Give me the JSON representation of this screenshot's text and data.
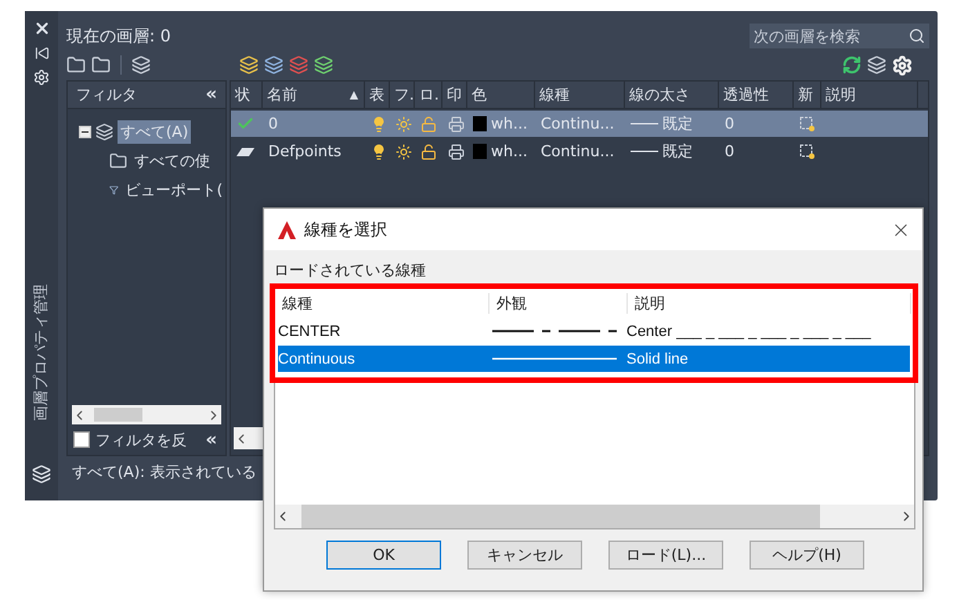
{
  "side_strip": {
    "title": "画層プロパティ管理"
  },
  "current_layer": "現在の画層: 0",
  "search": {
    "placeholder": "次の画層を検索"
  },
  "filter_pane": {
    "title": "フィルタ",
    "collapse": "«",
    "tree": [
      {
        "label": "すべて(A)",
        "selected": true,
        "expanded": true,
        "children": [
          {
            "label": "すべての使",
            "selected": false
          },
          {
            "label": "ビューポート(",
            "selected": false
          }
        ]
      }
    ],
    "invert_filter": {
      "label": "フィルタを反",
      "checked": false
    },
    "collapse_bottom": "«"
  },
  "layers_table": {
    "sort_indicator": "▲",
    "columns": [
      "状",
      "名前",
      "表",
      "フ.",
      "ロ.",
      "印",
      "色",
      "線種",
      "線の太さ",
      "透過性",
      "新",
      "説明"
    ],
    "rows": [
      {
        "current": true,
        "selected": true,
        "name": "0",
        "color_name": "wh...",
        "linetype": "Continu...",
        "lineweight": "既定",
        "transparency": "0"
      },
      {
        "current": false,
        "selected": false,
        "name": "Defpoints",
        "color_name": "wh...",
        "linetype": "Continu...",
        "lineweight": "既定",
        "transparency": "0"
      }
    ]
  },
  "status_bar": "すべて(A): 表示されている",
  "dialog": {
    "title": "線種を選択",
    "list_label": "ロードされている線種",
    "columns": [
      "線種",
      "外観",
      "説明"
    ],
    "rows": [
      {
        "name": "CENTER",
        "kind": "center",
        "description": "Center ___ _ ___ _ ___ _ ___ _ ___",
        "selected": false
      },
      {
        "name": "Continuous",
        "kind": "solid",
        "description": "Solid line",
        "selected": true
      }
    ],
    "buttons": [
      {
        "label": "OK",
        "default": true
      },
      {
        "label": "キャンセル",
        "default": false
      },
      {
        "label": "ロード(L)...",
        "default": false
      },
      {
        "label": "ヘルプ(H)",
        "default": false
      }
    ]
  }
}
